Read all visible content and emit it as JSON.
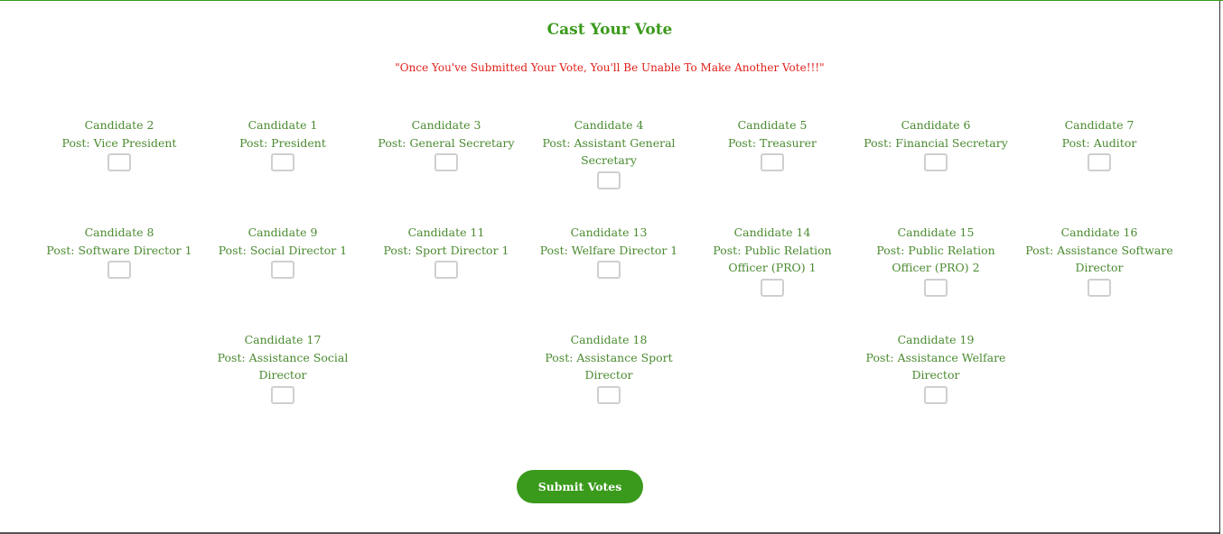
{
  "form": {
    "title": "Cast Your Vote",
    "warning": "\"Once You've Submitted Your Vote, You'll Be Unable To Make Another Vote!!!\"",
    "submit_label": "Submit Votes"
  },
  "candidates": [
    {
      "name": "Candidate 2",
      "post": "Post: Vice President"
    },
    {
      "name": "Candidate 1",
      "post": "Post: President"
    },
    {
      "name": "Candidate 3",
      "post": "Post: General Secretary"
    },
    {
      "name": "Candidate 4",
      "post": "Post: Assistant General Secretary"
    },
    {
      "name": "Candidate 5",
      "post": "Post: Treasurer"
    },
    {
      "name": "Candidate 6",
      "post": "Post: Financial Secretary"
    },
    {
      "name": "Candidate 7",
      "post": "Post: Auditor"
    },
    {
      "name": "Candidate 8",
      "post": "Post: Software Director 1"
    },
    {
      "name": "Candidate 9",
      "post": "Post: Social Director 1"
    },
    {
      "name": "Candidate 11",
      "post": "Post: Sport Director 1"
    },
    {
      "name": "Candidate 13",
      "post": "Post: Welfare Director 1"
    },
    {
      "name": "Candidate 14",
      "post": "Post: Public Relation Officer (PRO) 1"
    },
    {
      "name": "Candidate 15",
      "post": "Post: Public Relation Officer (PRO) 2"
    },
    {
      "name": "Candidate 16",
      "post": "Post: Assistance Software Director"
    },
    {
      "name": "Candidate 17",
      "post": "Post: Assistance Social Director"
    },
    {
      "name": "Candidate 18",
      "post": "Post: Assistance Sport Director"
    },
    {
      "name": "Candidate 19",
      "post": "Post: Assistance Welfare Director"
    }
  ]
}
